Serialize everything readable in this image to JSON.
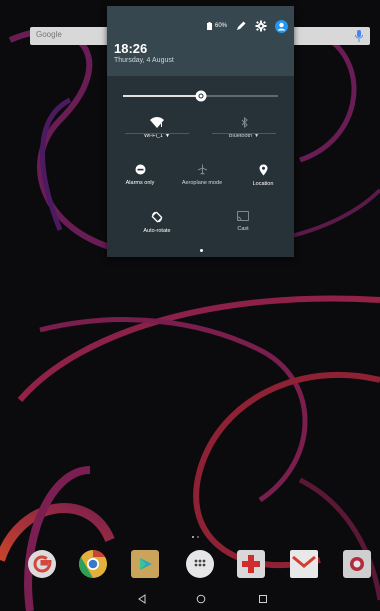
{
  "search": {
    "logo_text": "Google"
  },
  "status": {
    "battery": "60%"
  },
  "header": {
    "time": "18:26",
    "date": "Thursday, 4 August"
  },
  "brightness": {
    "level": 0.5
  },
  "tiles": {
    "wifi": {
      "label": "Wi-Fi_1",
      "icon": "wifi-icon"
    },
    "bluetooth": {
      "label": "Bluetooth",
      "icon": "bluetooth-icon"
    },
    "alarms": {
      "label": "Alarms only",
      "icon": "do-not-disturb-icon"
    },
    "aeroplane": {
      "label": "Aeroplane mode",
      "icon": "airplane-icon"
    },
    "location": {
      "label": "Location",
      "icon": "location-pin-icon"
    },
    "autorotate": {
      "label": "Auto-rotate",
      "icon": "auto-rotate-icon"
    },
    "cast": {
      "label": "Cast",
      "icon": "cast-icon"
    }
  },
  "dock": {
    "apps": [
      "google-app-icon",
      "chrome-icon",
      "play-store-icon",
      "app-drawer-icon",
      "health-app-icon",
      "gmail-icon",
      "camera-icon"
    ]
  },
  "nav": [
    "back-icon",
    "home-icon",
    "recents-icon"
  ],
  "colors": {
    "shade_bg": "#263238",
    "header_bg": "#37474f",
    "accent": "#2196f3"
  }
}
